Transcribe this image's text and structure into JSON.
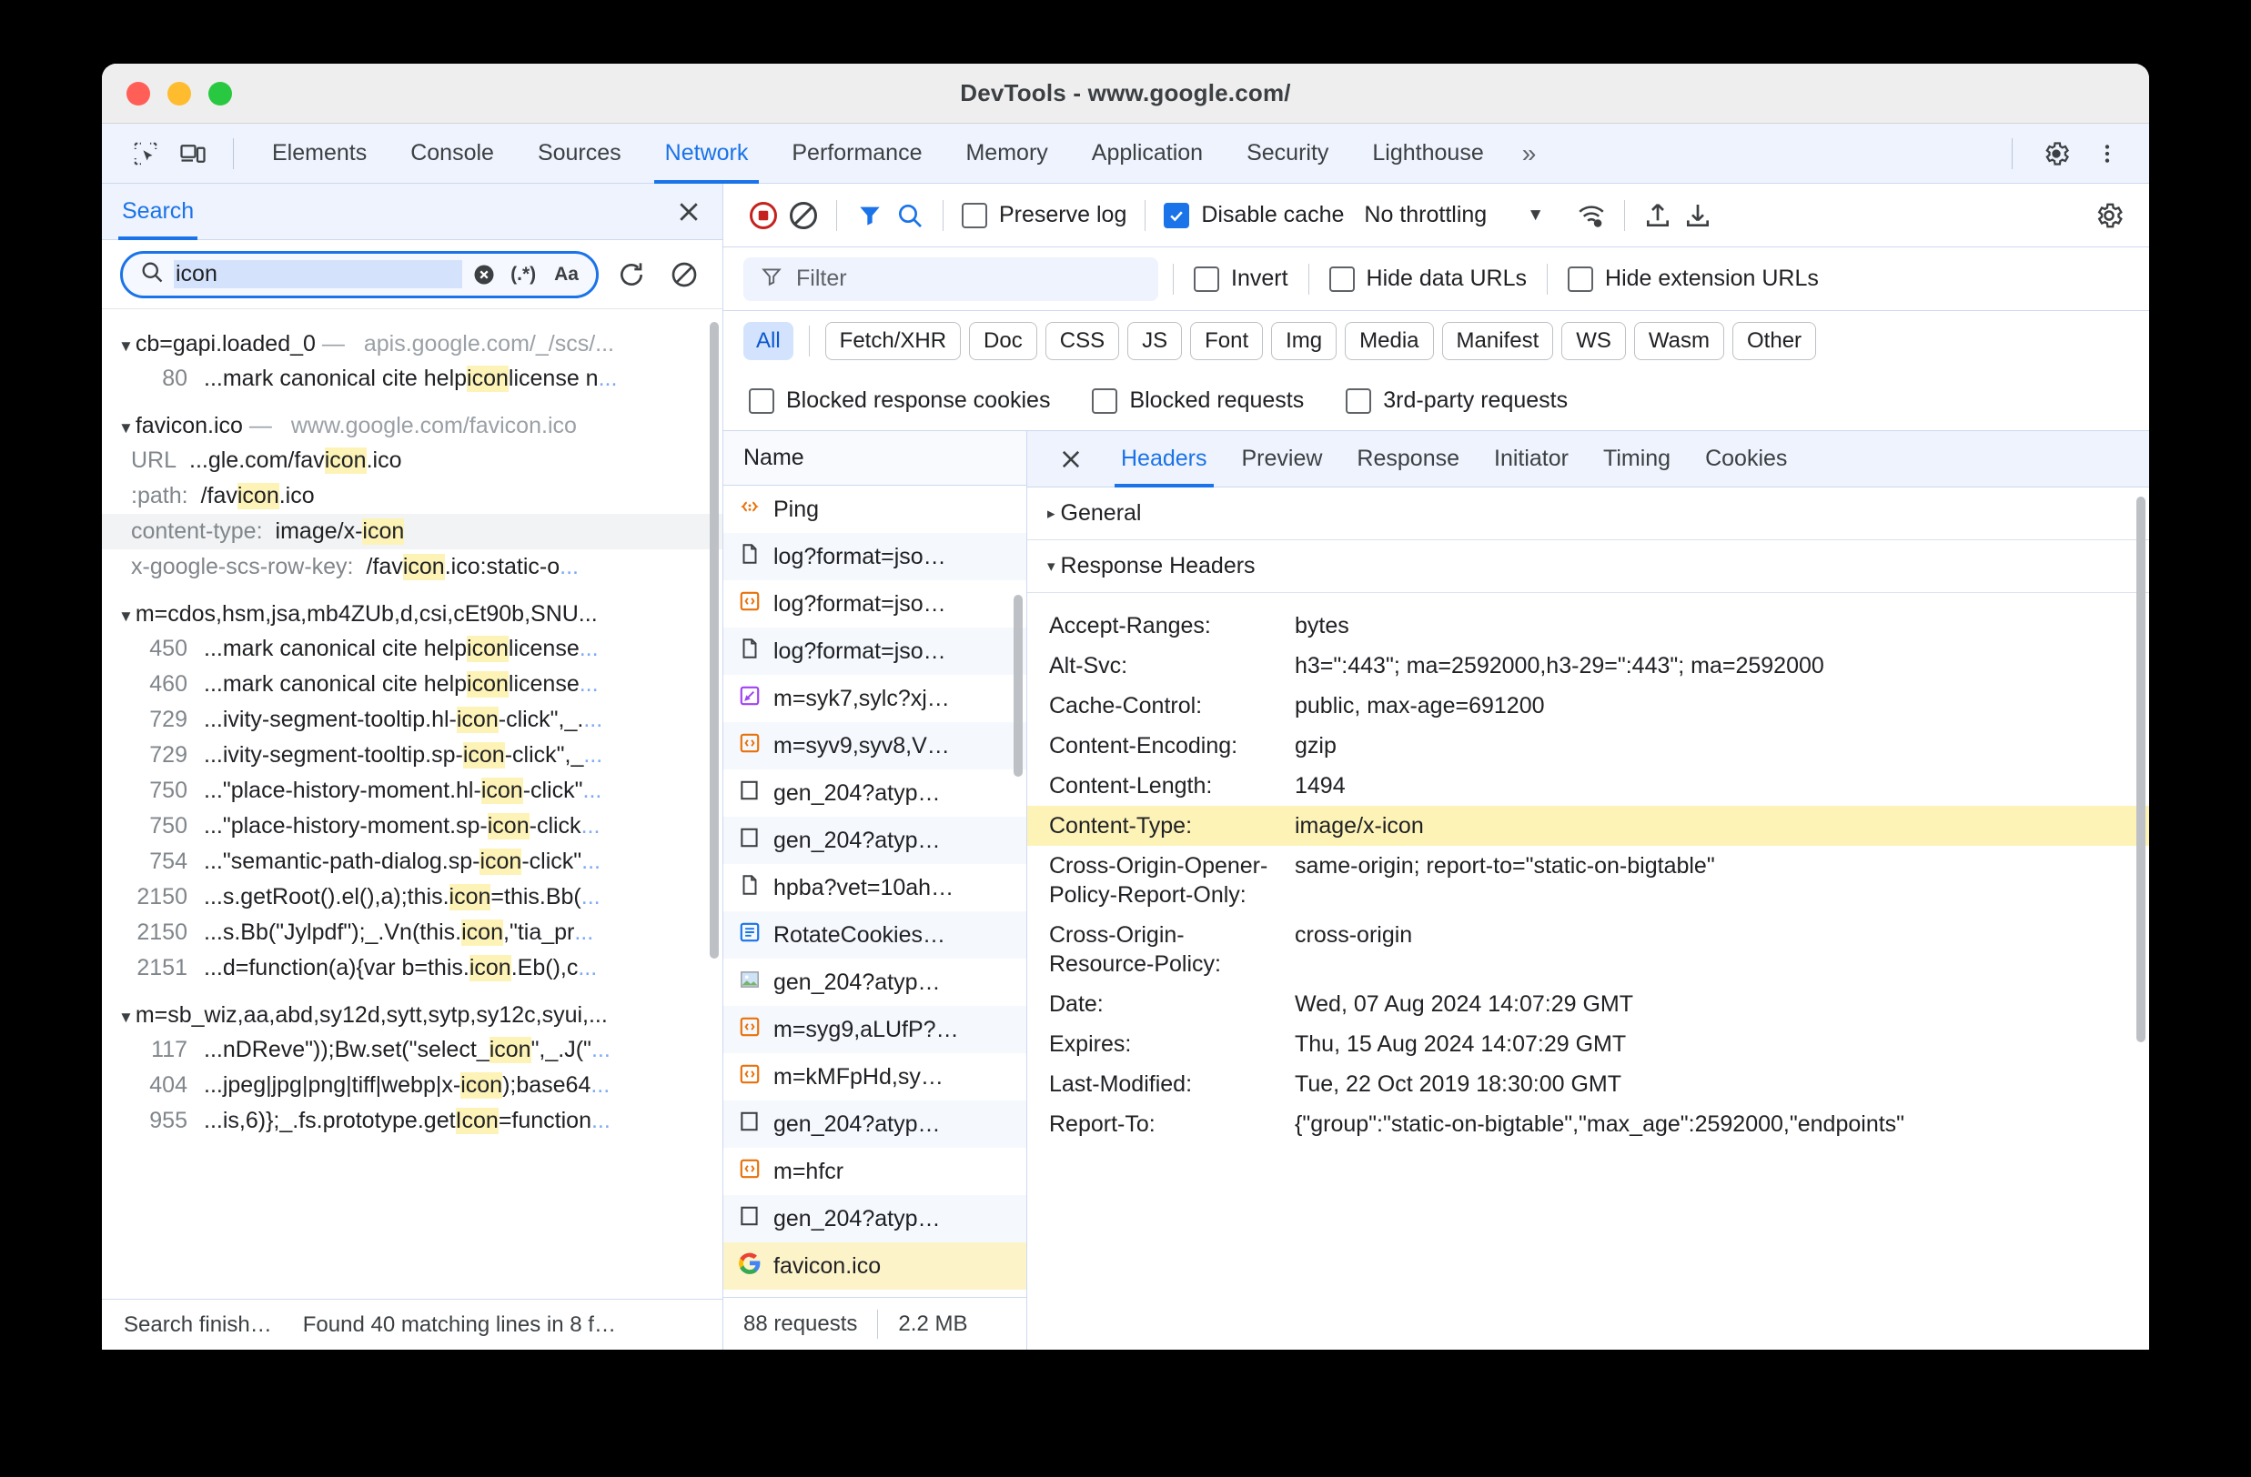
{
  "window": {
    "title": "DevTools - www.google.com/"
  },
  "main_tabs": [
    {
      "label": "Elements",
      "active": false
    },
    {
      "label": "Console",
      "active": false
    },
    {
      "label": "Sources",
      "active": false
    },
    {
      "label": "Network",
      "active": true
    },
    {
      "label": "Performance",
      "active": false
    },
    {
      "label": "Memory",
      "active": false
    },
    {
      "label": "Application",
      "active": false
    },
    {
      "label": "Security",
      "active": false
    },
    {
      "label": "Lighthouse",
      "active": false
    }
  ],
  "main_tabbar": {
    "inspect_icon": "inspect-element-icon",
    "device_icon": "device-toolbar-icon",
    "more_tabs": "»",
    "settings_icon": "gear-icon",
    "more_icon": "kebab-menu-icon"
  },
  "search_panel": {
    "tab_label": "Search",
    "close_icon": "close-icon",
    "query": "icon",
    "clear_icon": "clear-input-icon",
    "regex_label": "(.*)",
    "match_case_label": "Aa",
    "refresh_icon": "refresh-icon",
    "clear_results_icon": "clear-search-icon",
    "groups": [
      {
        "name": "cb=gapi.loaded_0",
        "url": "apis.google.com/_/scs/...",
        "lines": [
          {
            "ln": "80",
            "pre": "...mark canonical cite help ",
            "mark": "icon",
            "post": " license n",
            "ellipsis": "..."
          }
        ]
      },
      {
        "name": "favicon.ico",
        "url": "www.google.com/favicon.ico",
        "kvlines": [
          {
            "label": "URL",
            "pre": "...gle.com/fav",
            "mark": "icon",
            "post": ".ico",
            "hl": false
          },
          {
            "label": ":path:",
            "pre": "/fav",
            "mark": "icon",
            "post": ".ico",
            "hl": false
          },
          {
            "label": "content-type:",
            "pre": "image/x-",
            "mark": "icon",
            "post": "",
            "hl": true
          },
          {
            "label": "x-google-scs-row-key:",
            "pre": "/fav",
            "mark": "icon",
            "post": ".ico:static-o",
            "ellipsis": "...",
            "hl": false
          }
        ]
      },
      {
        "name": "m=cdos,hsm,jsa,mb4ZUb,d,csi,cEt90b,SNU...",
        "url": "",
        "lines": [
          {
            "ln": "450",
            "pre": "...mark canonical cite help ",
            "mark": "icon",
            "post": " license ",
            "ellipsis": "..."
          },
          {
            "ln": "460",
            "pre": "...mark canonical cite help ",
            "mark": "icon",
            "post": " license ",
            "ellipsis": "..."
          },
          {
            "ln": "729",
            "pre": "...ivity-segment-tooltip.hl-",
            "mark": "icon",
            "post": "-click\",_.",
            "ellipsis": "..."
          },
          {
            "ln": "729",
            "pre": "...ivity-segment-tooltip.sp-",
            "mark": "icon",
            "post": "-click\",_",
            "ellipsis": "..."
          },
          {
            "ln": "750",
            "pre": "...\"place-history-moment.hl-",
            "mark": "icon",
            "post": "-click\"",
            "ellipsis": "..."
          },
          {
            "ln": "750",
            "pre": "...\"place-history-moment.sp-",
            "mark": "icon",
            "post": "-click",
            "ellipsis": "..."
          },
          {
            "ln": "754",
            "pre": "...\"semantic-path-dialog.sp-",
            "mark": "icon",
            "post": "-click\"",
            "ellipsis": "..."
          },
          {
            "ln": "2150",
            "pre": "...s.getRoot().el(),a);this.",
            "mark": "icon",
            "post": "=this.Bb(",
            "ellipsis": "..."
          },
          {
            "ln": "2150",
            "pre": "...s.Bb(\"Jylpdf\");_.Vn(this.",
            "mark": "icon",
            "post": ",\"tia_pr",
            "ellipsis": "..."
          },
          {
            "ln": "2151",
            "pre": "...d=function(a){var b=this.",
            "mark": "icon",
            "post": ".Eb(),c",
            "ellipsis": "..."
          }
        ]
      },
      {
        "name": "m=sb_wiz,aa,abd,sy12d,sytt,sytp,sy12c,syui,...",
        "url": "",
        "lines": [
          {
            "ln": "117",
            "pre": "...nDReve\"));Bw.set(\"select_",
            "mark": "icon",
            "post": "\",_.J(\"",
            "ellipsis": "..."
          },
          {
            "ln": "404",
            "pre": "...jpeg|jpg|png|tiff|webp|x-",
            "mark": "icon",
            "post": ");base64",
            "ellipsis": "..."
          },
          {
            "ln": "955",
            "pre": "...is,6)};_.fs.prototype.get",
            "mark": "Icon",
            "post": "=function",
            "ellipsis": "..."
          }
        ]
      }
    ],
    "status_left": "Search finish…",
    "status_right": "Found 40 matching lines in 8 f…"
  },
  "network": {
    "toolbar": {
      "record_icon": "record-stop-icon",
      "clear_icon": "clear-network-icon",
      "filter_icon": "filter-funnel-icon",
      "search_icon": "search-icon",
      "preserve_log": {
        "label": "Preserve log",
        "checked": false
      },
      "disable_cache": {
        "label": "Disable cache",
        "checked": true
      },
      "throttling": "No throttling",
      "throttle_caret": "▼",
      "wifi_icon": "network-conditions-icon",
      "import_icon": "import-har-icon",
      "export_icon": "export-har-icon",
      "settings_icon": "network-settings-gear-icon"
    },
    "filter": {
      "funnel_icon": "filter-icon",
      "placeholder": "Filter",
      "invert": {
        "label": "Invert",
        "checked": false
      },
      "hide_data_urls": {
        "label": "Hide data URLs",
        "checked": false
      },
      "hide_extension_urls": {
        "label": "Hide extension URLs",
        "checked": false
      }
    },
    "types": [
      {
        "label": "All",
        "active": true
      },
      {
        "label": "Fetch/XHR",
        "active": false
      },
      {
        "label": "Doc",
        "active": false
      },
      {
        "label": "CSS",
        "active": false
      },
      {
        "label": "JS",
        "active": false
      },
      {
        "label": "Font",
        "active": false
      },
      {
        "label": "Img",
        "active": false
      },
      {
        "label": "Media",
        "active": false
      },
      {
        "label": "Manifest",
        "active": false
      },
      {
        "label": "WS",
        "active": false
      },
      {
        "label": "Wasm",
        "active": false
      },
      {
        "label": "Other",
        "active": false
      }
    ],
    "blocked_options": [
      {
        "label": "Blocked response cookies",
        "checked": false
      },
      {
        "label": "Blocked requests",
        "checked": false
      },
      {
        "label": "3rd-party requests",
        "checked": false
      }
    ],
    "list": {
      "column_header": "Name",
      "rows": [
        {
          "name": "Ping",
          "icon": "json-file-icon",
          "selected": false
        },
        {
          "name": "log?format=jso…",
          "icon": "document-file-icon",
          "selected": false
        },
        {
          "name": "log?format=jso…",
          "icon": "script-file-icon",
          "selected": false
        },
        {
          "name": "log?format=jso…",
          "icon": "document-file-icon",
          "selected": false
        },
        {
          "name": "m=syk7,sylc?xj…",
          "icon": "stylesheet-file-icon",
          "selected": false
        },
        {
          "name": "m=syv9,syv8,V…",
          "icon": "script-file-icon",
          "selected": false
        },
        {
          "name": "gen_204?atyp…",
          "icon": "generic-file-icon",
          "selected": false
        },
        {
          "name": "gen_204?atyp…",
          "icon": "generic-file-icon",
          "selected": false
        },
        {
          "name": "hpba?vet=10ah…",
          "icon": "document-file-icon",
          "selected": false
        },
        {
          "name": "RotateCookies…",
          "icon": "fetch-xhr-icon",
          "selected": false
        },
        {
          "name": "gen_204?atyp…",
          "icon": "image-file-icon",
          "selected": false
        },
        {
          "name": "m=syg9,aLUfP?…",
          "icon": "script-file-icon",
          "selected": false
        },
        {
          "name": "m=kMFpHd,sy…",
          "icon": "script-file-icon",
          "selected": false
        },
        {
          "name": "gen_204?atyp…",
          "icon": "generic-file-icon",
          "selected": false
        },
        {
          "name": "m=hfcr",
          "icon": "script-file-icon",
          "selected": false
        },
        {
          "name": "gen_204?atyp…",
          "icon": "generic-file-icon",
          "selected": false
        },
        {
          "name": "favicon.ico",
          "icon": "google-favicon-icon",
          "selected": true
        }
      ],
      "footer_requests": "88 requests",
      "footer_size": "2.2 MB"
    },
    "detail": {
      "close_icon": "close-panel-icon",
      "tabs": [
        {
          "label": "Headers",
          "active": true
        },
        {
          "label": "Preview",
          "active": false
        },
        {
          "label": "Response",
          "active": false
        },
        {
          "label": "Initiator",
          "active": false
        },
        {
          "label": "Timing",
          "active": false
        },
        {
          "label": "Cookies",
          "active": false
        }
      ],
      "general_section": {
        "label": "General",
        "expanded": false,
        "tri": "▸"
      },
      "response_section": {
        "label": "Response Headers",
        "expanded": true,
        "tri": "▾"
      },
      "headers": [
        {
          "key": "Accept-Ranges:",
          "value": "bytes",
          "highlight": false
        },
        {
          "key": "Alt-Svc:",
          "value": "h3=\":443\"; ma=2592000,h3-29=\":443\"; ma=2592000",
          "highlight": false
        },
        {
          "key": "Cache-Control:",
          "value": "public, max-age=691200",
          "highlight": false
        },
        {
          "key": "Content-Encoding:",
          "value": "gzip",
          "highlight": false
        },
        {
          "key": "Content-Length:",
          "value": "1494",
          "highlight": false
        },
        {
          "key": "Content-Type:",
          "value": "image/x-icon",
          "highlight": true
        },
        {
          "key": "Cross-Origin-Opener-Policy-Report-Only:",
          "value": "same-origin; report-to=\"static-on-bigtable\"",
          "highlight": false
        },
        {
          "key": "Cross-Origin-Resource-Policy:",
          "value": "cross-origin",
          "highlight": false
        },
        {
          "key": "Date:",
          "value": "Wed, 07 Aug 2024 14:07:29 GMT",
          "highlight": false
        },
        {
          "key": "Expires:",
          "value": "Thu, 15 Aug 2024 14:07:29 GMT",
          "highlight": false
        },
        {
          "key": "Last-Modified:",
          "value": "Tue, 22 Oct 2019 18:30:00 GMT",
          "highlight": false
        },
        {
          "key": "Report-To:",
          "value": "{\"group\":\"static-on-bigtable\",\"max_age\":2592000,\"endpoints\"",
          "highlight": false
        }
      ]
    }
  },
  "colors": {
    "accent": "#1a73e8",
    "highlight": "#fdf3b7",
    "chip_active_bg": "#d3e3fd",
    "record_red": "#c5221f"
  }
}
